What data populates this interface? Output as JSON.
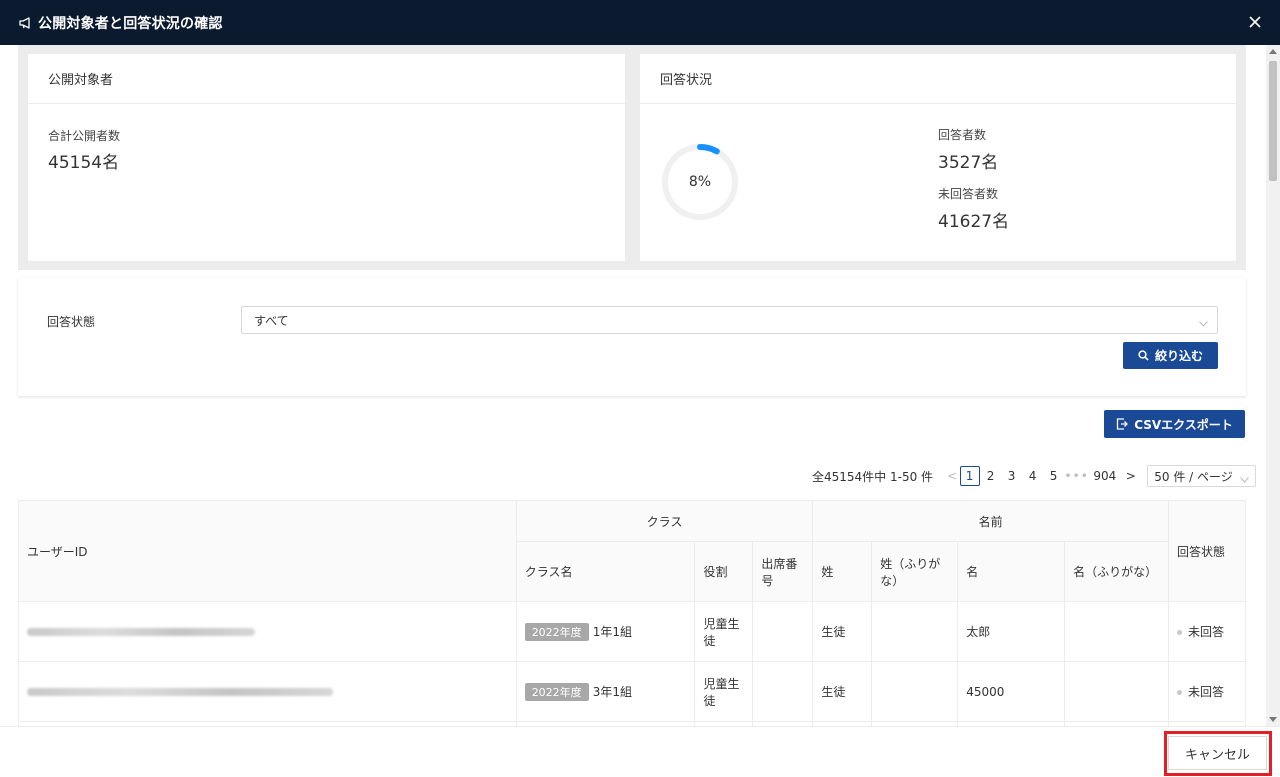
{
  "dialog": {
    "title": "公開対象者と回答状況の確認",
    "close_icon": "close-icon",
    "megaphone_icon": "megaphone-icon"
  },
  "stats": {
    "targets": {
      "header": "公開対象者",
      "total_label": "合計公開者数",
      "total_value": "45154名"
    },
    "response": {
      "header": "回答状況",
      "percent": "8%",
      "percent_value": 8,
      "answered_label": "回答者数",
      "answered_value": "3527名",
      "unanswered_label": "未回答者数",
      "unanswered_value": "41627名"
    }
  },
  "filter": {
    "status_label": "回答状態",
    "status_selected": "すべて",
    "filter_button": "絞り込む"
  },
  "export": {
    "csv_button": "CSVエクスポート"
  },
  "pagination": {
    "summary": "全45154件中 1-50 件",
    "prev": "<",
    "pages": [
      "1",
      "2",
      "3",
      "4",
      "5"
    ],
    "dots": "•••",
    "last_page": "904",
    "next": ">",
    "page_size": "50 件 / ページ"
  },
  "table": {
    "headers": {
      "user_id": "ユーザーID",
      "class_group": "クラス",
      "name_group": "名前",
      "status": "回答状態",
      "class_name": "クラス名",
      "role": "役割",
      "seat_no": "出席番号",
      "last_name": "姓",
      "last_name_kana": "姓（ふりがな）",
      "first_name": "名",
      "first_name_kana": "名（ふりがな）"
    },
    "rows": [
      {
        "year_tag": "2022年度",
        "class_name": "1年1組",
        "role": "児童生徒",
        "seat_no": "",
        "last_name": "生徒",
        "last_name_kana": "",
        "first_name": "太郎",
        "first_name_kana": "",
        "status": "未回答"
      },
      {
        "year_tag": "2022年度",
        "class_name": "3年1組",
        "role": "児童生徒",
        "seat_no": "",
        "last_name": "生徒",
        "last_name_kana": "",
        "first_name": "45000",
        "first_name_kana": "",
        "status": "未回答"
      }
    ]
  },
  "footer": {
    "cancel_button": "キャンセル"
  },
  "colors": {
    "titlebar": "#0c1a30",
    "primary": "#1a4a95",
    "progress": "#1890ff",
    "highlight": "#e31e25"
  }
}
